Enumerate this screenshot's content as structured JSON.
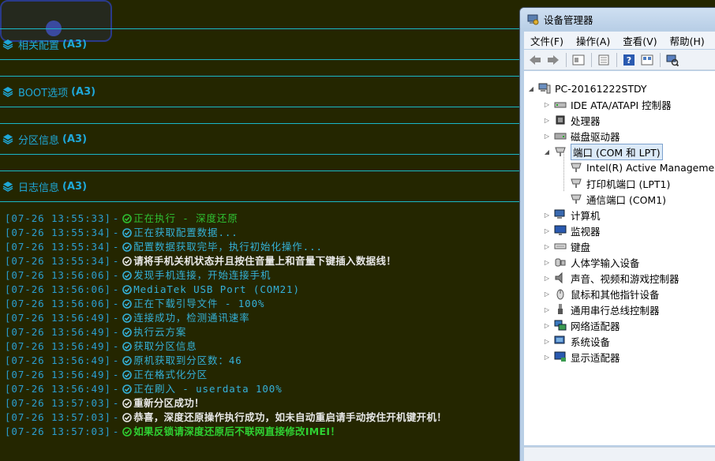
{
  "tool": {
    "sections": [
      {
        "name": "相关配置",
        "tag": "(A3)"
      },
      {
        "name": "BOOT选项",
        "tag": "(A3)"
      },
      {
        "name": "分区信息",
        "tag": "(A3)"
      },
      {
        "name": "日志信息",
        "tag": "(A3)"
      }
    ],
    "log": [
      {
        "ts": "[07-26 13:55:33]",
        "msg": "正在执行 - 深度还原",
        "style": "green",
        "icon": "check-circle-green-icon"
      },
      {
        "ts": "[07-26 13:55:34]",
        "msg": "正在获取配置数据...",
        "style": "cyan",
        "icon": "check-circle-cyan-icon"
      },
      {
        "ts": "[07-26 13:55:34]",
        "msg": "配置数据获取完毕，执行初始化操作...",
        "style": "cyan",
        "icon": "check-circle-cyan-icon"
      },
      {
        "ts": "[07-26 13:55:34]",
        "msg": "请将手机关机状态并且按住音量上和音量下键插入数据线！",
        "style": "white",
        "icon": "check-circle-white-icon"
      },
      {
        "ts": "[07-26 13:56:06]",
        "msg": "发现手机连接，开始连接手机",
        "style": "cyan",
        "icon": "check-circle-cyan-icon"
      },
      {
        "ts": "[07-26 13:56:06]",
        "msg": "MediaTek USB Port (COM21)",
        "style": "cyan",
        "icon": "check-circle-cyan-icon"
      },
      {
        "ts": "[07-26 13:56:06]",
        "msg": "正在下载引导文件 - 100%",
        "style": "cyan",
        "icon": "check-circle-cyan-icon"
      },
      {
        "ts": "[07-26 13:56:49]",
        "msg": "连接成功，检测通讯速率",
        "style": "cyan",
        "icon": "check-circle-cyan-icon"
      },
      {
        "ts": "[07-26 13:56:49]",
        "msg": "执行云方案",
        "style": "cyan",
        "icon": "check-circle-cyan-icon"
      },
      {
        "ts": "[07-26 13:56:49]",
        "msg": "获取分区信息",
        "style": "cyan",
        "icon": "check-circle-cyan-icon"
      },
      {
        "ts": "[07-26 13:56:49]",
        "msg": "原机获取到分区数：46",
        "style": "cyan",
        "icon": "check-circle-cyan-icon"
      },
      {
        "ts": "[07-26 13:56:49]",
        "msg": "正在格式化分区",
        "style": "cyan",
        "icon": "check-circle-cyan-icon"
      },
      {
        "ts": "[07-26 13:56:49]",
        "msg": "正在刷入 - userdata 100%",
        "style": "cyan",
        "icon": "check-circle-cyan-icon"
      },
      {
        "ts": "[07-26 13:57:03]",
        "msg": "重新分区成功！",
        "style": "white",
        "icon": "check-circle-white-icon"
      },
      {
        "ts": "[07-26 13:57:03]",
        "msg": "恭喜，深度还原操作执行成功，如未自动重启请手动按住开机键开机！",
        "style": "white",
        "icon": "check-circle-white-icon"
      },
      {
        "ts": "[07-26 13:57:03]",
        "msg": "如果反锁请深度还原后不联网直接修改IMEI！",
        "style": "bgreen",
        "icon": "check-circle-green-icon"
      }
    ],
    "separator": "-"
  },
  "device_manager": {
    "title": "设备管理器",
    "menu": [
      "文件(F)",
      "操作(A)",
      "查看(V)",
      "帮助(H)"
    ],
    "toolbar_icons": [
      "back-icon",
      "forward-icon",
      "properties-icon",
      "update-icon",
      "help-icon",
      "view-icon",
      "scan-hardware-icon"
    ],
    "tree": {
      "root": "PC-20161222STDY",
      "items": [
        {
          "label": "IDE ATA/ATAPI 控制器",
          "icon": "ide-controller-icon",
          "expanded": false
        },
        {
          "label": "处理器",
          "icon": "processor-icon",
          "expanded": false
        },
        {
          "label": "磁盘驱动器",
          "icon": "disk-drive-icon",
          "expanded": false
        },
        {
          "label": "端口 (COM 和 LPT)",
          "icon": "port-icon",
          "expanded": true,
          "selected": true,
          "children": [
            {
              "label": "Intel(R) Active Management",
              "icon": "port-icon"
            },
            {
              "label": "打印机端口 (LPT1)",
              "icon": "port-icon"
            },
            {
              "label": "通信端口 (COM1)",
              "icon": "port-icon"
            }
          ]
        },
        {
          "label": "计算机",
          "icon": "computer-icon",
          "expanded": false
        },
        {
          "label": "监视器",
          "icon": "monitor-icon",
          "expanded": false
        },
        {
          "label": "键盘",
          "icon": "keyboard-icon",
          "expanded": false
        },
        {
          "label": "人体学输入设备",
          "icon": "hid-icon",
          "expanded": false
        },
        {
          "label": "声音、视频和游戏控制器",
          "icon": "sound-icon",
          "expanded": false
        },
        {
          "label": "鼠标和其他指针设备",
          "icon": "mouse-icon",
          "expanded": false
        },
        {
          "label": "通用串行总线控制器",
          "icon": "usb-icon",
          "expanded": false
        },
        {
          "label": "网络适配器",
          "icon": "network-icon",
          "expanded": false
        },
        {
          "label": "系统设备",
          "icon": "system-icon",
          "expanded": false
        },
        {
          "label": "显示适配器",
          "icon": "display-icon",
          "expanded": false
        }
      ]
    }
  }
}
